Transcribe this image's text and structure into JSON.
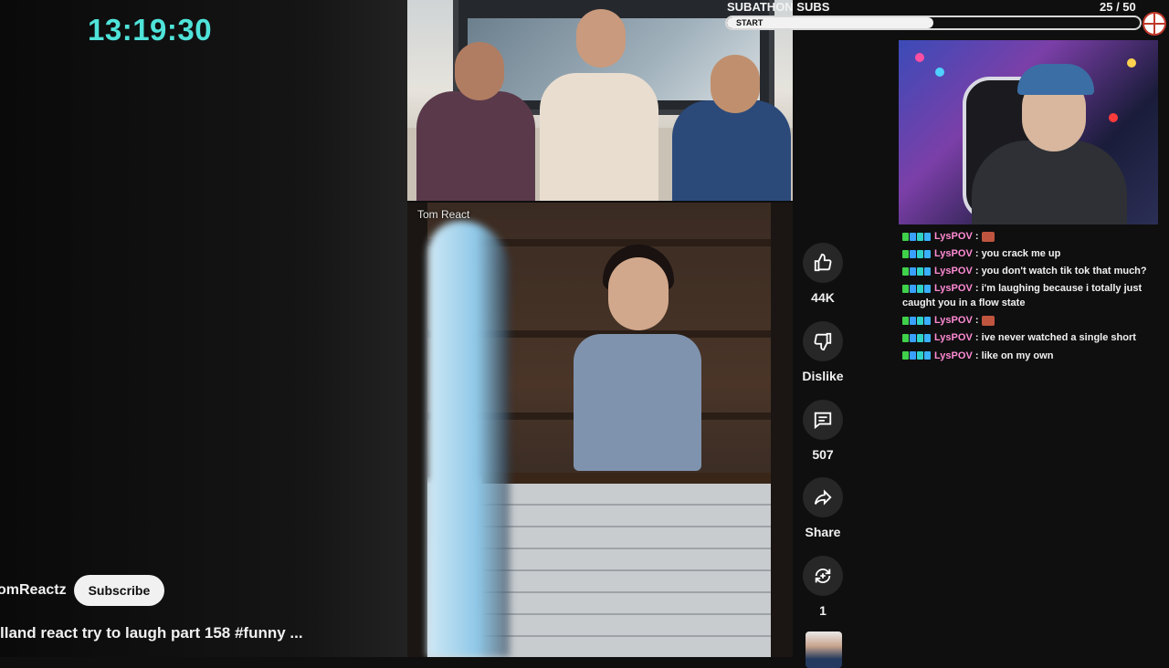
{
  "timer": "13:19:30",
  "channel": {
    "name": "omReactz",
    "subscribe_label": "Subscribe"
  },
  "video_title": "lland react try to laugh part 158 #funny ...",
  "overlay_tag": "Tom React",
  "actions": {
    "like_count": "44K",
    "dislike_label": "Dislike",
    "comment_count": "507",
    "share_label": "Share",
    "remix_count": "1"
  },
  "subathon": {
    "title": "SUBATHON SUBS",
    "count": "25  / 50",
    "start_label": "START",
    "progress": 0.5
  },
  "chat": [
    {
      "user": "LysPOV",
      "message": "",
      "emote": true
    },
    {
      "user": "LysPOV",
      "message": "you crack me up",
      "emote": false
    },
    {
      "user": "LysPOV",
      "message": "you don't watch tik tok that much?",
      "emote": false
    },
    {
      "user": "LysPOV",
      "message": "i'm laughing because i totally just caught you in a flow state",
      "emote": false
    },
    {
      "user": "LysPOV",
      "message": "",
      "emote": true
    },
    {
      "user": "LysPOV",
      "message": "ive never watched a single short",
      "emote": false
    },
    {
      "user": "LysPOV",
      "message": "like on my own",
      "emote": false
    }
  ],
  "colors": {
    "timer": "#4fe3d9",
    "chat_user": "#ff8bd4",
    "background": "#0f0f0f"
  },
  "icons": [
    "thumbs-up-icon",
    "thumbs-down-icon",
    "comment-icon",
    "share-icon",
    "remix-icon",
    "crosshair-icon"
  ]
}
